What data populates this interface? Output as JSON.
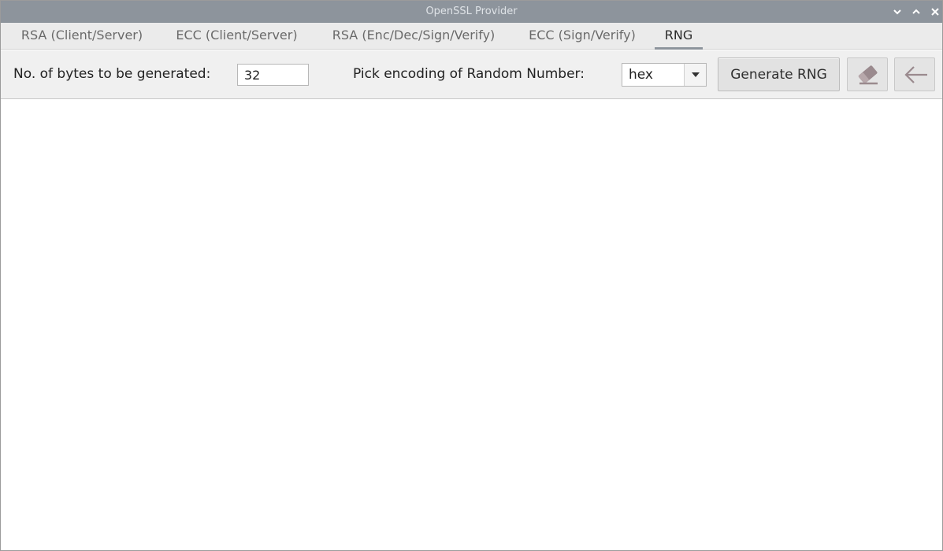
{
  "window": {
    "title": "OpenSSL Provider",
    "controls": [
      "chevron-down-icon",
      "chevron-up-icon",
      "close-icon"
    ]
  },
  "tabs": [
    {
      "label": "RSA (Client/Server)",
      "active": false
    },
    {
      "label": "ECC (Client/Server)",
      "active": false
    },
    {
      "label": "RSA (Enc/Dec/Sign/Verify)",
      "active": false
    },
    {
      "label": "ECC (Sign/Verify)",
      "active": false
    },
    {
      "label": "RNG",
      "active": true
    }
  ],
  "rng": {
    "bytes_label": "No. of bytes to be generated:",
    "bytes_value": "32",
    "encoding_label": "Pick encoding of Random Number:",
    "encoding_selected": "hex",
    "generate_label": "Generate RNG",
    "clear_icon": "eraser-icon",
    "back_icon": "arrow-left-icon",
    "output": ""
  },
  "colors": {
    "titlebar": "#8d949c",
    "tab_indicator": "#8d949c",
    "toolbar_bg": "#f0f0f0",
    "icon_glyph": "#9a8a8e"
  }
}
